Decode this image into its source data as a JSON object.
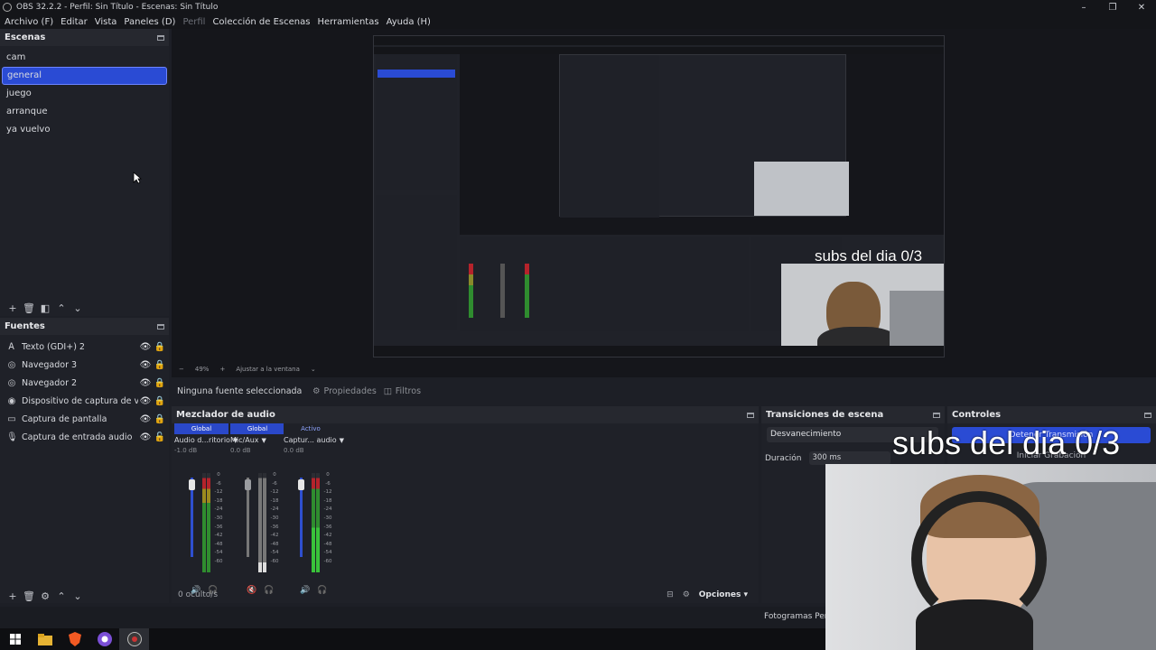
{
  "window": {
    "title": "OBS 32.2.2 - Perfil: Sin Título - Escenas: Sin Título",
    "controls": [
      "–",
      "❐",
      "✕"
    ]
  },
  "menu": [
    {
      "label": "Archivo (F)",
      "disabled": false
    },
    {
      "label": "Editar",
      "disabled": false
    },
    {
      "label": "Vista",
      "disabled": false
    },
    {
      "label": "Paneles (D)",
      "disabled": false
    },
    {
      "label": "Perfil",
      "disabled": true
    },
    {
      "label": "Colección de Escenas",
      "disabled": false
    },
    {
      "label": "Herramientas",
      "disabled": false
    },
    {
      "label": "Ayuda (H)",
      "disabled": false
    }
  ],
  "scenes": {
    "title": "Escenas",
    "items": [
      "cam",
      "general",
      "juego",
      "arranque",
      "ya vuelvo"
    ],
    "selected": "general"
  },
  "sources": {
    "title": "Fuentes",
    "items": [
      {
        "label": "Texto (GDI+) 2",
        "icon": "text-icon"
      },
      {
        "label": "Navegador 3",
        "icon": "globe-icon"
      },
      {
        "label": "Navegador 2",
        "icon": "globe-icon"
      },
      {
        "label": "Dispositivo de captura de video",
        "icon": "camera-icon"
      },
      {
        "label": "Captura de pantalla",
        "icon": "monitor-icon"
      },
      {
        "label": "Captura de entrada audio",
        "icon": "microphone-icon"
      }
    ]
  },
  "preview": {
    "zoom": "49%",
    "fit_label": "Ajustar a la ventana",
    "overlay_text": "subs del dia 0/3"
  },
  "context": {
    "no_source": "Ninguna fuente seleccionada",
    "properties": "Propiedades",
    "filters": "Filtros"
  },
  "mixer": {
    "title": "Mezclador de audio",
    "channels": [
      {
        "head": "Global",
        "name": "Audio d...ritorio",
        "db": "-1.0 dB",
        "active": false
      },
      {
        "head": "Global",
        "name": "Mic/Aux",
        "db": "0.0 dB",
        "active": false
      },
      {
        "head": "Activo",
        "name": "Captur... audio",
        "db": "0.0 dB",
        "active": true
      }
    ],
    "scale": [
      "0",
      "-6",
      "-12",
      "-18",
      "-24",
      "-30",
      "-36",
      "-42",
      "-48",
      "-54",
      "-60"
    ],
    "hidden": "0 oculto/s",
    "options": "Opciones"
  },
  "transitions": {
    "title": "Transiciones de escena",
    "selected": "Desvanecimiento",
    "duration_label": "Duración",
    "duration_value": "300 ms"
  },
  "controls": {
    "title": "Controles",
    "stop_stream": "Detener Transmisión",
    "start_recording": "Iniciar Grabación"
  },
  "status": {
    "fps": "Fotogramas Perd"
  },
  "colors": {
    "accent": "#2a4bd4",
    "background": "#1f2128"
  }
}
